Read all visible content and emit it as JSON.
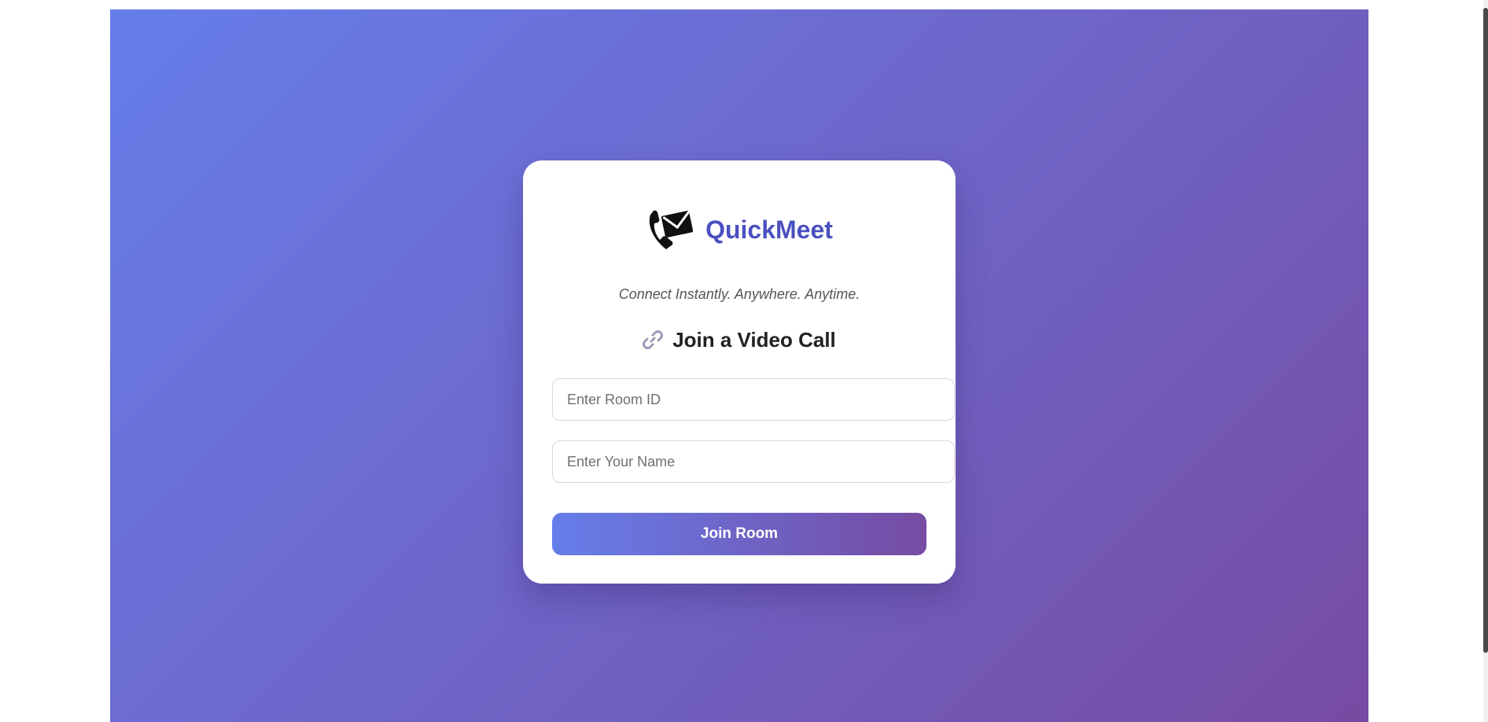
{
  "brand": {
    "name": "QuickMeet",
    "icon": "phone-envelope-icon",
    "color": "#4a50c0"
  },
  "tagline": "Connect Instantly. Anywhere. Anytime.",
  "join_section": {
    "icon": "link-icon",
    "title": "Join a Video Call"
  },
  "form": {
    "room_id_placeholder": "Enter Room ID",
    "room_id_value": "",
    "name_placeholder": "Enter Your Name",
    "name_value": "",
    "submit_label": "Join Room"
  },
  "colors": {
    "gradient_start": "#667eea",
    "gradient_end": "#764ba2",
    "card_background": "#ffffff"
  }
}
